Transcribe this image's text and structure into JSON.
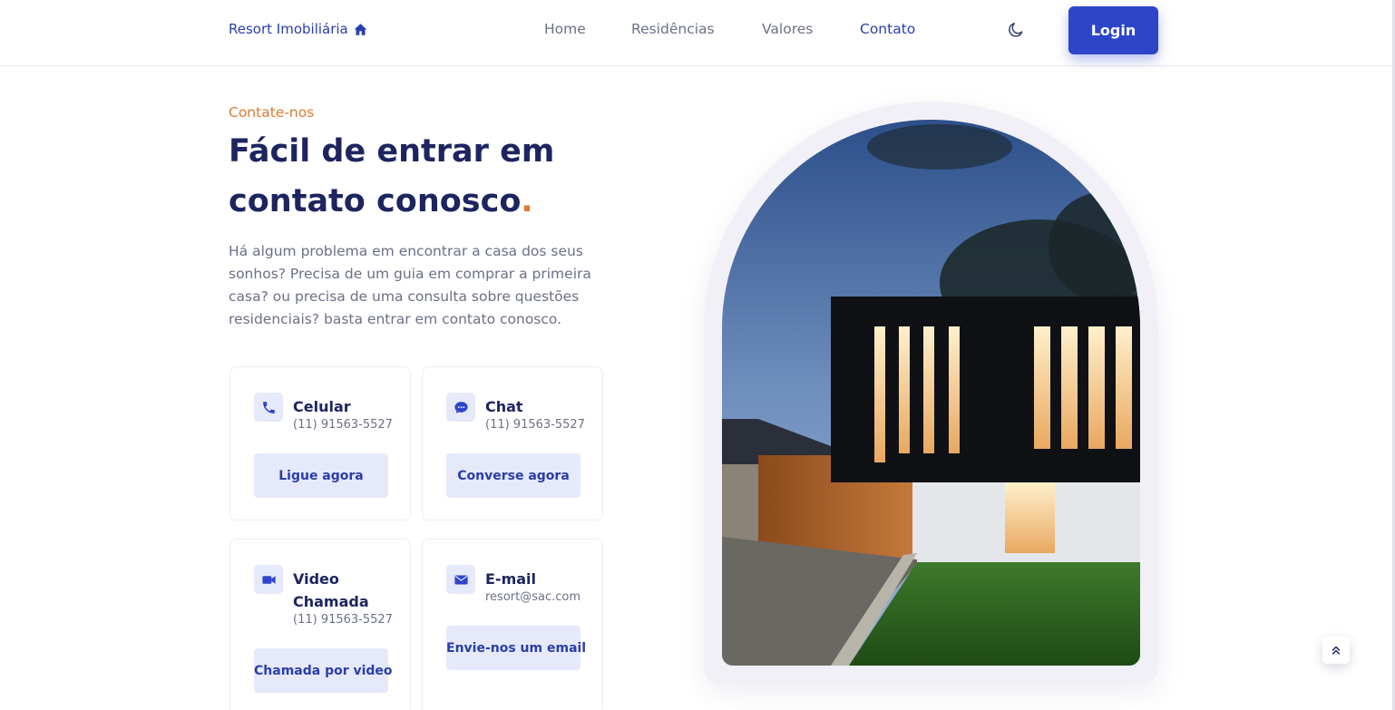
{
  "header": {
    "brand": "Resort Imobiliária",
    "nav": [
      {
        "label": "Home"
      },
      {
        "label": "Residências"
      },
      {
        "label": "Valores"
      },
      {
        "label": "Contato"
      }
    ],
    "login_label": "Login"
  },
  "hero": {
    "kicker": "Contate-nos",
    "title_line1": "Fácil de entrar em",
    "title_line2": "contato conosco",
    "title_dot": ".",
    "description": "Há algum problema em encontrar a casa dos seus sonhos? Precisa de um guia em comprar a primeira casa? ou precisa de uma consulta sobre questões residenciais? basta entrar em contato conosco."
  },
  "contacts": [
    {
      "label": "Celular",
      "value": "(11) 91563-5527",
      "button": "Ligue agora",
      "icon": "phone-icon"
    },
    {
      "label": "Chat",
      "value": "(11) 91563-5527",
      "button": "Converse agora",
      "icon": "chat-icon"
    },
    {
      "label": "Video Chamada",
      "value": "(11) 91563-5527",
      "button": "Chamada por video",
      "icon": "video-icon"
    },
    {
      "label": "E-mail",
      "value": "resort@sac.com",
      "button": "Envie-nos um email",
      "icon": "email-icon"
    }
  ],
  "colors": {
    "accent": "#2d45c9",
    "orange": "#e07a2f",
    "dark": "#1d2560"
  }
}
